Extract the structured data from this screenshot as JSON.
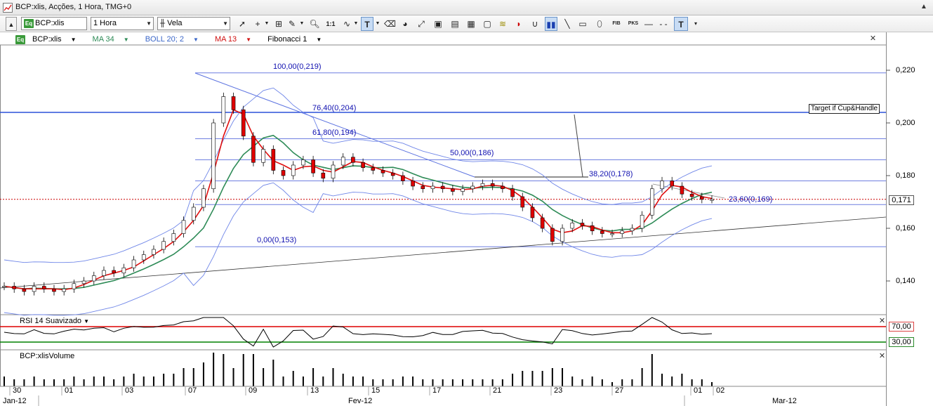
{
  "window": {
    "title": "BCP:xlis, Acções, 1 Hora, TMG+0"
  },
  "toolbar": {
    "symbol": "BCP:xlis",
    "symbol_badge": "Eq",
    "interval": "1 Hora",
    "chart_style": "Vela",
    "ratio_label": "1:1",
    "fib_label": "FIB",
    "pks_label": "PKS",
    "text_tool": "T"
  },
  "legend": {
    "symbol": "BCP:xlis",
    "badge": "Eq",
    "ma34": "MA 34",
    "boll": "BOLL 20; 2",
    "ma13": "MA 13",
    "fib": "Fibonacci 1"
  },
  "price_axis": {
    "ticks": [
      "0,220",
      "0,200",
      "0,180",
      "0,160",
      "0,140"
    ],
    "current_price": "0,171"
  },
  "fibonacci_levels": [
    {
      "label": "100,00(0,219)",
      "value": 0.219
    },
    {
      "label": "76,40(0,204)",
      "value": 0.204
    },
    {
      "label": "61,80(0,194)",
      "value": 0.194
    },
    {
      "label": "50,00(0,186)",
      "value": 0.186
    },
    {
      "label": "38,20(0,178)",
      "value": 0.178
    },
    {
      "label": "23,60(0,169)",
      "value": 0.169
    },
    {
      "label": "0,00(0,153)",
      "value": 0.153
    }
  ],
  "annotation": {
    "target_text": "Target if Cup&Handle"
  },
  "rsi_pane": {
    "title": "RSI 14 Suavizado",
    "upper_label": "70,00",
    "lower_label": "30,00"
  },
  "volume_pane": {
    "title": "BCP:xlisVolume"
  },
  "time_axis": {
    "day_labels": [
      "30",
      "01",
      "03",
      "07",
      "09",
      "13",
      "15",
      "17",
      "21",
      "23",
      "27",
      "01",
      "02"
    ],
    "month_labels": [
      "Jan-12",
      "Fev-12",
      "Mar-12"
    ]
  },
  "colors": {
    "fib_line": "#0000cc",
    "boll": "#6f86e8",
    "ma34": "#2e8b57",
    "ma13": "#e01010",
    "candle_up": "#ffffff",
    "candle_down": "#e00000",
    "rsi_upper": "#dd0000",
    "rsi_lower": "#008000"
  },
  "chart_data": {
    "type": "candlestick",
    "interval": "1 Hora",
    "ylim": [
      0.128,
      0.232
    ],
    "candles_close": [
      0.138,
      0.137,
      0.136,
      0.138,
      0.137,
      0.136,
      0.137,
      0.139,
      0.14,
      0.142,
      0.144,
      0.143,
      0.145,
      0.148,
      0.15,
      0.152,
      0.155,
      0.158,
      0.163,
      0.168,
      0.175,
      0.2,
      0.21,
      0.205,
      0.195,
      0.185,
      0.19,
      0.182,
      0.18,
      0.184,
      0.186,
      0.181,
      0.179,
      0.184,
      0.187,
      0.185,
      0.183,
      0.182,
      0.181,
      0.18,
      0.178,
      0.176,
      0.175,
      0.176,
      0.175,
      0.174,
      0.175,
      0.176,
      0.177,
      0.176,
      0.175,
      0.172,
      0.168,
      0.164,
      0.16,
      0.155,
      0.16,
      0.162,
      0.161,
      0.159,
      0.158,
      0.158,
      0.159,
      0.16,
      0.165,
      0.175,
      0.178,
      0.176,
      0.173,
      0.172,
      0.171,
      0.171
    ]
  }
}
